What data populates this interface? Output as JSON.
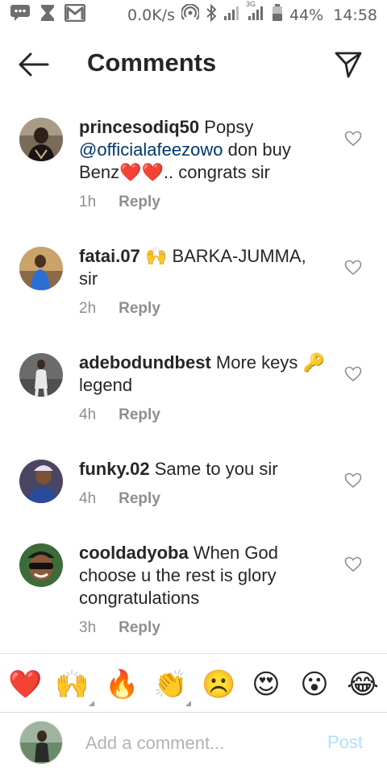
{
  "status_bar": {
    "net_speed": "0.0K/s",
    "network_type": "3G",
    "battery": "44%",
    "time": "14:58",
    "icons": [
      "message-icon",
      "hourglass-icon",
      "gmail-icon",
      "hotspot-icon",
      "bluetooth-icon",
      "signal-icon",
      "signal-3g-icon",
      "battery-icon"
    ]
  },
  "header": {
    "title": "Comments",
    "back_icon": "arrow-left-icon",
    "send_icon": "paper-plane-icon"
  },
  "comments": [
    {
      "username": "princesodiq50",
      "text_before": " Popsy ",
      "mention": "@officialafeezowo",
      "text_after": "  don buy Benz❤️❤️.. congrats sir",
      "time": "1h",
      "reply": "Reply"
    },
    {
      "username": "fatai.07",
      "text_before": " 🙌 BARKA-JUMMA, sir",
      "time": "2h",
      "reply": "Reply"
    },
    {
      "username": "adebodundbest",
      "text_before": " More keys 🔑 legend",
      "time": "4h",
      "reply": "Reply"
    },
    {
      "username": "funky.02",
      "text_before": " Same to you sir",
      "time": "4h",
      "reply": "Reply"
    },
    {
      "username": "cooldadyoba",
      "text_before": " When God choose u the rest is glory congratulations",
      "time": "3h",
      "reply": "Reply"
    }
  ],
  "emoji_bar": [
    "❤️",
    "🙌",
    "🔥",
    "👏",
    "☹️",
    "😍",
    "😮",
    "😂"
  ],
  "compose": {
    "placeholder": "Add a comment...",
    "post_label": "Post"
  },
  "colors": {
    "mention": "#00376b",
    "post_disabled": "#b2dffc",
    "meta_gray": "#8e8e8e",
    "divider": "#dbdbdb"
  }
}
